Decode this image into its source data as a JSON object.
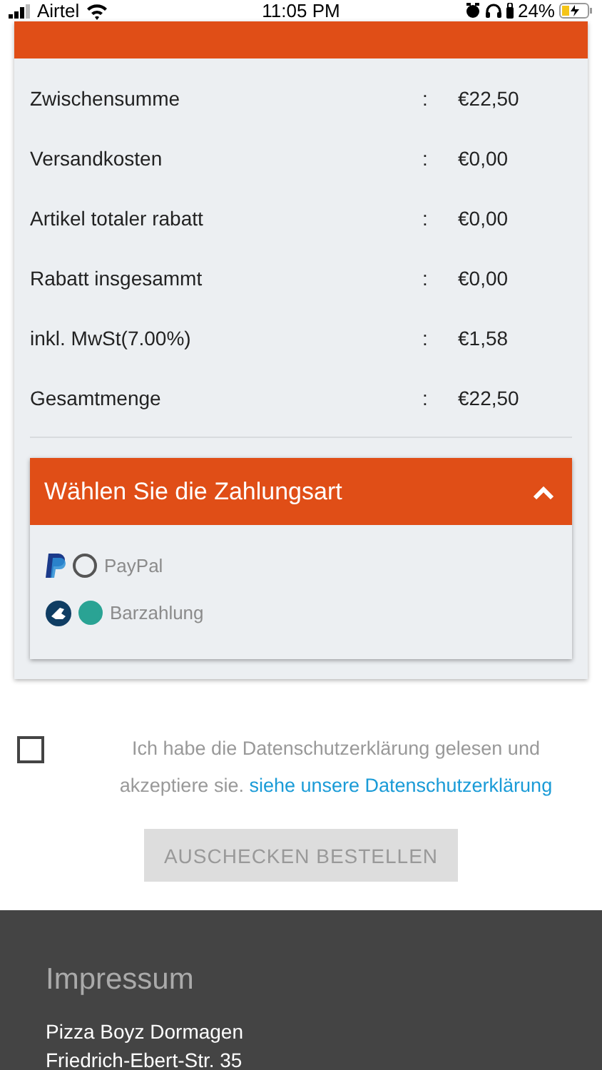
{
  "status_bar": {
    "carrier": "Airtel",
    "time": "11:05 PM",
    "battery": "24%"
  },
  "summary": {
    "rows": [
      {
        "label": "Zwischensumme",
        "separator": ":",
        "value": "€22,50"
      },
      {
        "label": "Versandkosten",
        "separator": ":",
        "value": "€0,00"
      },
      {
        "label": "Artikel totaler rabatt",
        "separator": ":",
        "value": "€0,00"
      },
      {
        "label": "Rabatt insgesammt",
        "separator": ":",
        "value": "€0,00"
      },
      {
        "label": "inkl. MwSt(7.00%)",
        "separator": ":",
        "value": "€1,58"
      },
      {
        "label": "Gesamtmenge",
        "separator": ":",
        "value": "€22,50"
      }
    ]
  },
  "payment": {
    "title": "Wählen Sie die Zahlungsart",
    "expanded": true,
    "options": [
      {
        "kind": "paypal",
        "label": "PayPal",
        "selected": false
      },
      {
        "kind": "cash",
        "label": "Barzahlung",
        "selected": true
      }
    ]
  },
  "consent": {
    "checked": false,
    "text": "Ich habe die Datenschutzerklärung gelesen und akzeptiere sie.",
    "link": "siehe unsere Datenschutzerklärung"
  },
  "checkout_button": {
    "label": "AUSCHECKEN BESTELLEN",
    "disabled": true
  },
  "footer": {
    "title": "Impressum",
    "lines": [
      "Pizza Boyz Dormagen",
      "Friedrich-Ebert-Str. 35"
    ]
  }
}
